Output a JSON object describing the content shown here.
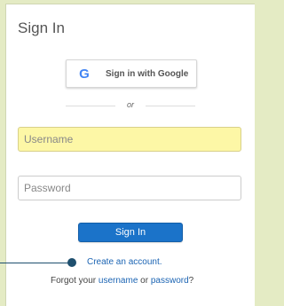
{
  "login": {
    "title": "Sign In",
    "google_button_label": "Sign in with Google",
    "google_icon_glyph": "G",
    "divider_text": "or",
    "username_placeholder": "Username",
    "password_placeholder": "Password",
    "submit_label": "Sign In",
    "create_account_link": "Create an account.",
    "forgot_prefix": "Forgot your ",
    "forgot_username_link": "username",
    "forgot_middle": " or ",
    "forgot_password_link": "password",
    "forgot_suffix": "?"
  },
  "colors": {
    "background": "#e4ebc4",
    "primary_button": "#1b73c9",
    "link": "#1b64b3",
    "username_highlight": "#fdf7a6",
    "pointer": "#1e4f6e"
  }
}
